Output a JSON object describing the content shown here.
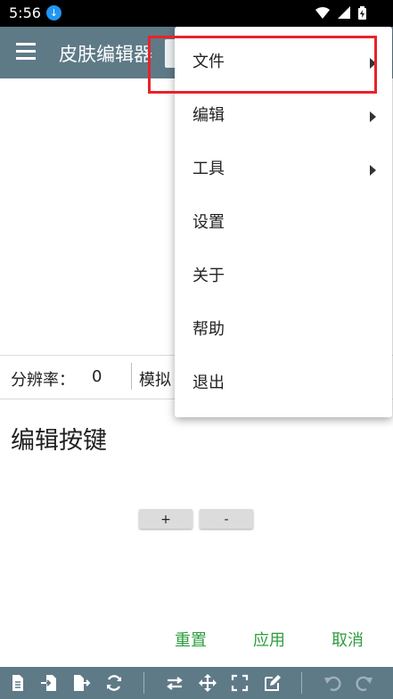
{
  "status_bar": {
    "time": "5:56",
    "icons": [
      "download-icon",
      "wifi-icon",
      "signal-icon",
      "battery-icon"
    ]
  },
  "app_bar": {
    "title": "皮肤编辑器"
  },
  "info_bar": {
    "resolution_label": "分辨率：",
    "resolution_value": "0",
    "simulate_label": "模拟"
  },
  "section": {
    "title": "编辑按键"
  },
  "steppers": {
    "plus": "+",
    "minus": "-"
  },
  "actions": {
    "reset": "重置",
    "apply": "应用",
    "cancel": "取消"
  },
  "menu": {
    "items": [
      {
        "label": "文件",
        "submenu": true
      },
      {
        "label": "编辑",
        "submenu": true
      },
      {
        "label": "工具",
        "submenu": true
      },
      {
        "label": "设置",
        "submenu": false
      },
      {
        "label": "关于",
        "submenu": false
      },
      {
        "label": "帮助",
        "submenu": false
      },
      {
        "label": "退出",
        "submenu": false
      }
    ]
  },
  "toolbar": {
    "icons": [
      "new-file-icon",
      "import-icon",
      "export-icon",
      "refresh-icon",
      "swap-icon",
      "move-icon",
      "fullscreen-icon",
      "edit-icon",
      "undo-icon",
      "redo-icon"
    ]
  },
  "colors": {
    "app_bar": "#5f7a87",
    "accent_green": "#2e9e3e",
    "highlight_red": "#e8232a"
  }
}
